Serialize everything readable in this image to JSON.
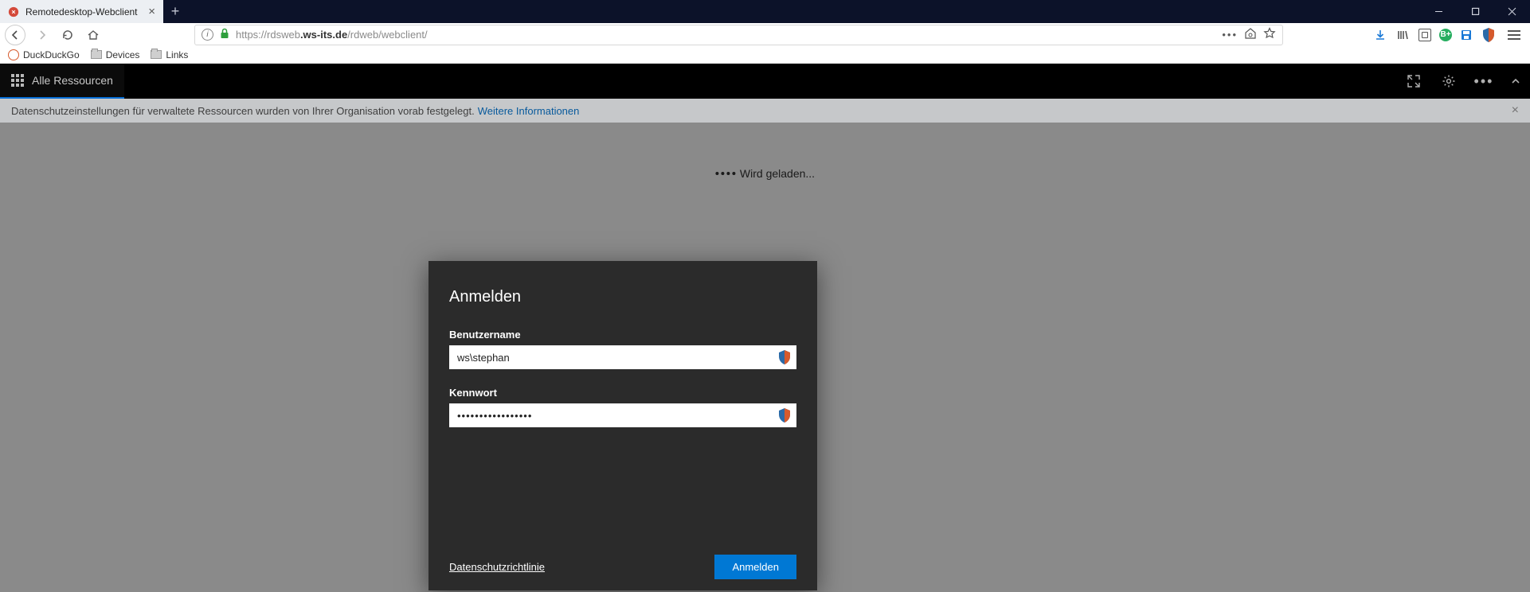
{
  "browser": {
    "tab_title": "Remotedesktop-Webclient",
    "url_prefix": "https://rdsweb",
    "url_host": ".ws-its.de",
    "url_path": "/rdweb/webclient/",
    "bookmarks": [
      {
        "label": "DuckDuckGo",
        "icon": "ddg"
      },
      {
        "label": "Devices",
        "icon": "folder"
      },
      {
        "label": "Links",
        "icon": "folder"
      }
    ]
  },
  "app": {
    "header_tab": "Alle Ressourcen",
    "banner_text": "Datenschutzeinstellungen für verwaltete Ressourcen wurden von Ihrer Organisation vorab festgelegt.",
    "banner_link": "Weitere Informationen",
    "loading_text": "Wird geladen..."
  },
  "login": {
    "title": "Anmelden",
    "username_label": "Benutzername",
    "username_value": "ws\\stephan",
    "password_label": "Kennwort",
    "password_value": "•••••••••••••••••",
    "privacy_label": "Datenschutzrichtlinie",
    "submit_label": "Anmelden"
  }
}
